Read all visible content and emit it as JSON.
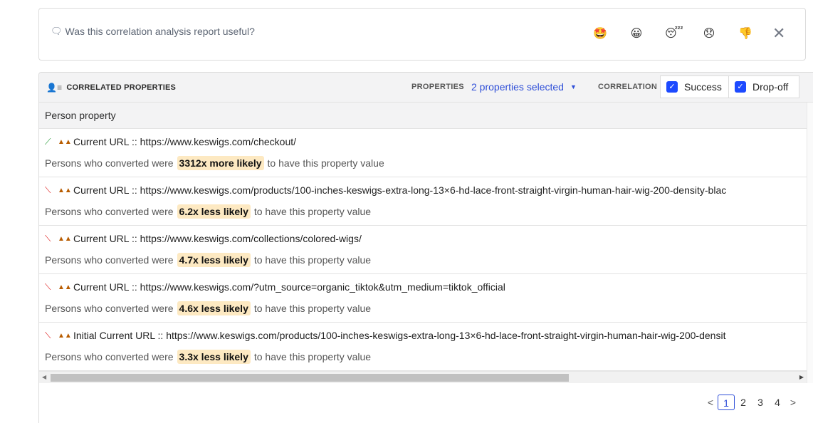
{
  "feedback": {
    "question": "Was this correlation analysis report useful?",
    "question_icon": "chat-bubble-icon",
    "emojis": [
      {
        "name": "star-eyes-emoji",
        "glyph": "🤩"
      },
      {
        "name": "grinning-emoji",
        "glyph": "😀"
      },
      {
        "name": "sleepy-emoji",
        "glyph": "😴"
      },
      {
        "name": "disappointed-emoji",
        "glyph": "😞"
      },
      {
        "name": "thumbs-down-emoji",
        "glyph": "👎"
      }
    ],
    "close_glyph": "✕"
  },
  "panel": {
    "title": "CORRELATED PROPERTIES",
    "properties_label": "PROPERTIES",
    "properties_selected": "2 properties selected",
    "correlation_label": "CORRELATION",
    "success_label": "Success",
    "dropoff_label": "Drop-off",
    "column_header": "Person property"
  },
  "rows": [
    {
      "trend": "up",
      "property": "Current URL :: https://www.keswigs.com/checkout/",
      "prefix": "Persons who converted were",
      "likelihood": "3312x more likely",
      "suffix": "to have this property value"
    },
    {
      "trend": "down",
      "property": "Current URL :: https://www.keswigs.com/products/100-inches-keswigs-extra-long-13×6-hd-lace-front-straight-virgin-human-hair-wig-200-density-blac",
      "prefix": "Persons who converted were",
      "likelihood": "6.2x less likely",
      "suffix": "to have this property value"
    },
    {
      "trend": "down",
      "property": "Current URL :: https://www.keswigs.com/collections/colored-wigs/",
      "prefix": "Persons who converted were",
      "likelihood": "4.7x less likely",
      "suffix": "to have this property value"
    },
    {
      "trend": "down",
      "property": "Current URL :: https://www.keswigs.com/?utm_source=organic_tiktok&utm_medium=tiktok_official",
      "prefix": "Persons who converted were",
      "likelihood": "4.6x less likely",
      "suffix": "to have this property value"
    },
    {
      "trend": "down",
      "property": "Initial Current URL :: https://www.keswigs.com/products/100-inches-keswigs-extra-long-13×6-hd-lace-front-straight-virgin-human-hair-wig-200-densit",
      "prefix": "Persons who converted were",
      "likelihood": "3.3x less likely",
      "suffix": "to have this property value"
    }
  ],
  "pagination": {
    "pages": [
      "1",
      "2",
      "3",
      "4"
    ],
    "current": "1",
    "prev": "<",
    "next": ">"
  },
  "colors": {
    "accent": "#1d4aff",
    "highlight": "#fde9c2",
    "trend_up": "#2a9d3a",
    "trend_down": "#e02020"
  }
}
